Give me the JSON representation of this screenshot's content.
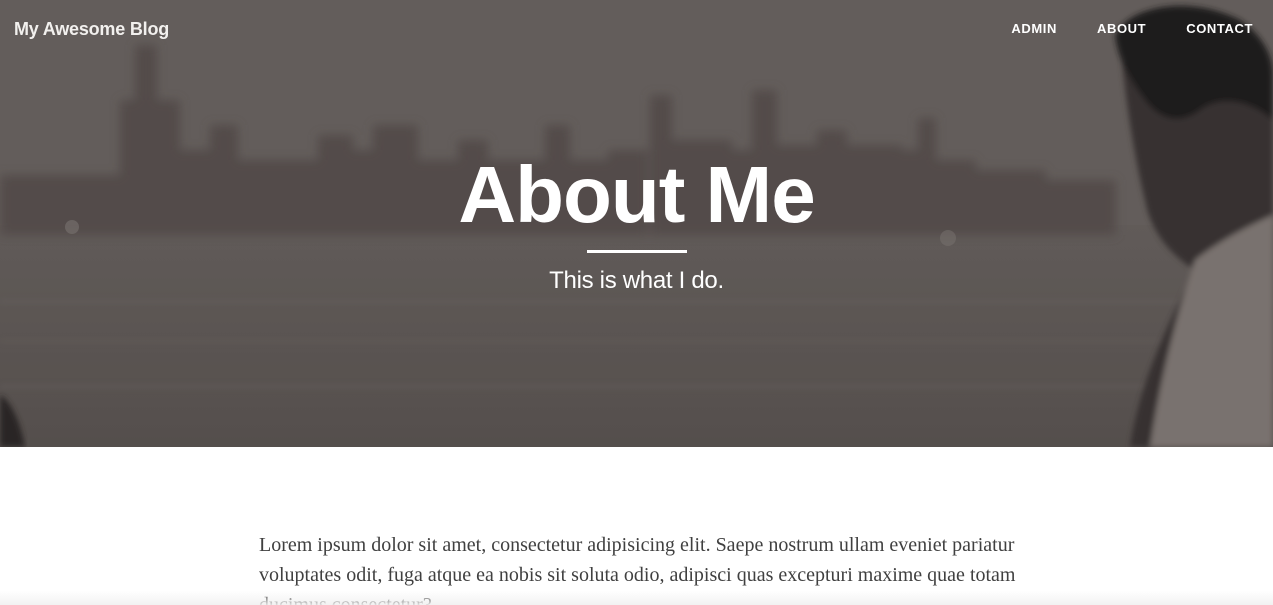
{
  "header": {
    "brand": "My Awesome Blog",
    "nav": [
      {
        "label": "ADMIN"
      },
      {
        "label": "ABOUT"
      },
      {
        "label": "CONTACT"
      }
    ]
  },
  "hero": {
    "title": "About Me",
    "subtitle": "This is what I do."
  },
  "content": {
    "paragraph": "Lorem ipsum dolor sit amet, consectetur adipisicing elit. Saepe nostrum ullam eveniet pariatur voluptates odit, fuga atque ea nobis sit soluta odio, adipisci quas excepturi maxime quae totam ducimus consectetur?"
  },
  "colors": {
    "hero_tone": "#6f6966",
    "text": "#404040"
  }
}
